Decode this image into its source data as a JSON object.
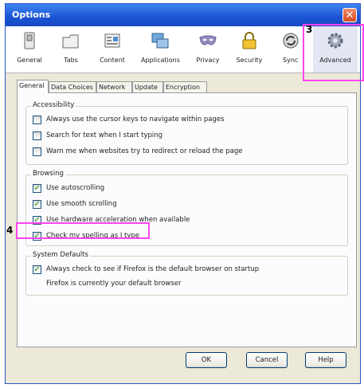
{
  "window": {
    "title": "Options"
  },
  "toolbar": {
    "items": [
      {
        "label": "General",
        "icon": "general-switch-icon"
      },
      {
        "label": "Tabs",
        "icon": "tabs-icon"
      },
      {
        "label": "Content",
        "icon": "content-icon"
      },
      {
        "label": "Applications",
        "icon": "applications-icon"
      },
      {
        "label": "Privacy",
        "icon": "privacy-mask-icon"
      },
      {
        "label": "Security",
        "icon": "security-lock-icon"
      },
      {
        "label": "Sync",
        "icon": "sync-icon"
      },
      {
        "label": "Advanced",
        "icon": "gear-icon",
        "selected": true
      }
    ]
  },
  "callouts": {
    "step3": "3",
    "step4": "4",
    "color": "#ff44ee"
  },
  "tabs": [
    {
      "label": "General",
      "active": true
    },
    {
      "label": "Data Choices"
    },
    {
      "label": "Network"
    },
    {
      "label": "Update"
    },
    {
      "label": "Encryption"
    }
  ],
  "accessibility": {
    "title": "Accessibility",
    "items": [
      {
        "label": "Always use the cursor keys to navigate within pages",
        "checked": false
      },
      {
        "label": "Search for text when I start typing",
        "checked": false
      },
      {
        "label": "Warn me when websites try to redirect or reload the page",
        "checked": false
      }
    ]
  },
  "browsing": {
    "title": "Browsing",
    "items": [
      {
        "label": "Use autoscrolling",
        "checked": true
      },
      {
        "label": "Use smooth scrolling",
        "checked": true
      },
      {
        "label": "Use hardware acceleration when available",
        "checked": true
      },
      {
        "label": "Check my spelling as I type",
        "checked": true
      }
    ]
  },
  "system_defaults": {
    "title": "System Defaults",
    "check_default": {
      "label": "Always check to see if Firefox is the default browser on startup",
      "checked": true
    },
    "status": "Firefox is currently your default browser"
  },
  "buttons": {
    "ok": "OK",
    "cancel": "Cancel",
    "help": "Help"
  }
}
